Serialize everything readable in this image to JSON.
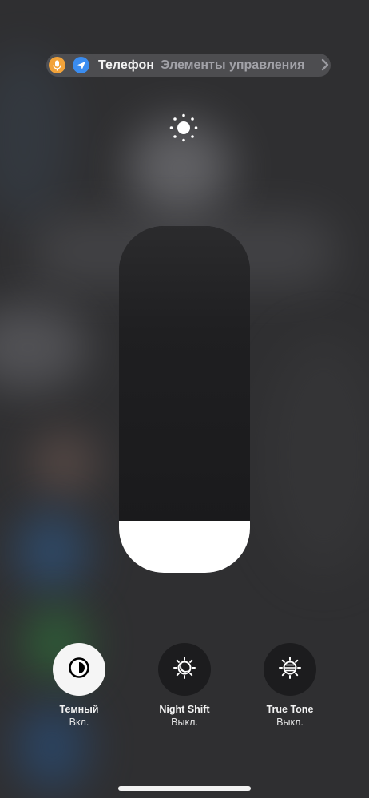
{
  "status_pill": {
    "app_name": "Телефон",
    "section": "Элементы управления",
    "mic_color": "#f2a33a",
    "location_color": "#3a8cf0"
  },
  "brightness": {
    "icon": "sun-icon",
    "level_percent": 15
  },
  "controls": [
    {
      "title": "Темный",
      "state": "Вкл.",
      "icon": "dark-mode-icon",
      "active": true
    },
    {
      "title": "Night Shift",
      "state": "Выкл.",
      "icon": "night-shift-icon",
      "active": false
    },
    {
      "title": "True Tone",
      "state": "Выкл.",
      "icon": "true-tone-icon",
      "active": false
    }
  ]
}
